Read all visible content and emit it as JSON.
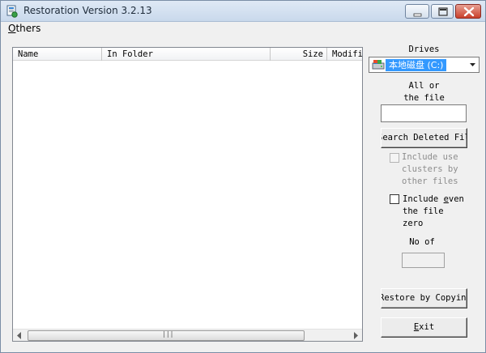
{
  "window": {
    "title": "Restoration Version 3.2.13"
  },
  "menu": {
    "others_hotkey": "O",
    "others_rest": "thers"
  },
  "list": {
    "columns": [
      "Name",
      "In Folder",
      "Size",
      "Modifi"
    ],
    "rows": []
  },
  "scrollbar": {
    "grip": "|||"
  },
  "panel": {
    "drives_label": "Drives",
    "drive_selected": "本地磁盘 (C:)",
    "all_or_line1": "All or",
    "all_or_line2": "the file",
    "file_input_value": "",
    "search_button": "Search Deleted Files",
    "include_clusters_line1": "Include use",
    "include_clusters_line2": "clusters by",
    "include_clusters_line3": "other files",
    "include_even_line1": "Include even",
    "include_even_line2": "the file",
    "include_even_line3": "zero",
    "include_even_hotkey": "e",
    "no_of_label": "No of",
    "no_of_value": "",
    "restore_button": "Restore by Copying",
    "exit_button": "Exit"
  },
  "colors": {
    "title_bar": "#c9d9ec",
    "selection": "#3399ff",
    "close_button": "#c9402b"
  },
  "icons": [
    "app-icon",
    "minimize-icon",
    "maximize-icon",
    "close-icon",
    "drive-icon",
    "dropdown-arrow-icon",
    "scroll-left-icon",
    "scroll-right-icon"
  ]
}
